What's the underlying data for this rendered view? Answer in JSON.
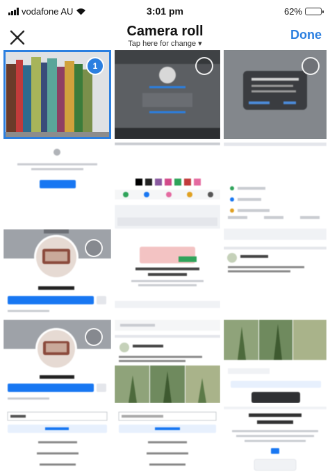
{
  "status_bar": {
    "carrier": "vodafone AU",
    "time": "3:01 pm",
    "battery": "62%",
    "battery_level": 0.62
  },
  "nav": {
    "close_icon": "close-icon",
    "title": "Camera roll",
    "subtitle": "Tap here for change ▾",
    "done_label": "Done"
  },
  "selection": {
    "selected_count": "1"
  },
  "colors": {
    "accent": "#2b7fe0",
    "fb_blue": "#1877f2"
  }
}
